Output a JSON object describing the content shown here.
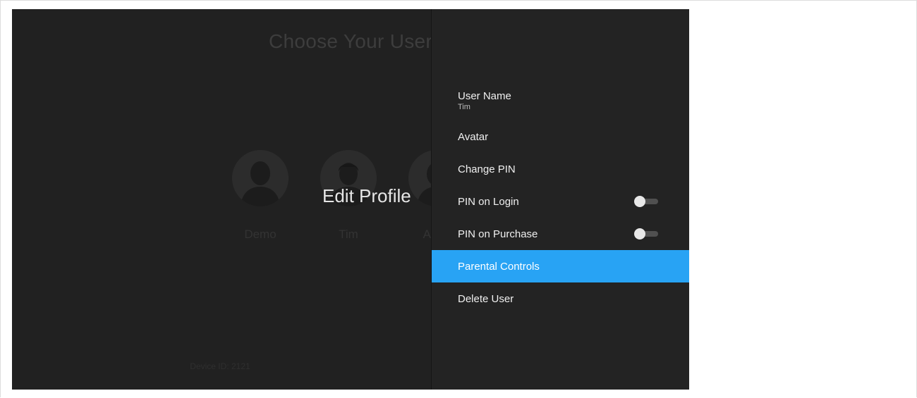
{
  "background": {
    "title": "Choose Your User",
    "users": [
      {
        "name": "Demo",
        "icon": "person-avatar-icon"
      },
      {
        "name": "Tim",
        "icon": "person-avatar-icon"
      },
      {
        "name": "Addy",
        "icon": "person-avatar-icon"
      }
    ],
    "device_id": "Device ID: 2121"
  },
  "overlay": {
    "title": "Edit Profile"
  },
  "panel": {
    "items": [
      {
        "label": "User Name",
        "value": "Tim"
      },
      {
        "label": "Avatar"
      },
      {
        "label": "Change PIN"
      },
      {
        "label": "PIN on Login",
        "toggle": "off"
      },
      {
        "label": "PIN on Purchase",
        "toggle": "off"
      },
      {
        "label": "Parental Controls",
        "selected": true
      },
      {
        "label": "Delete User"
      }
    ]
  },
  "colors": {
    "accent": "#28a3f4",
    "screen_bg": "#212121",
    "panel_bg": "#232323"
  }
}
